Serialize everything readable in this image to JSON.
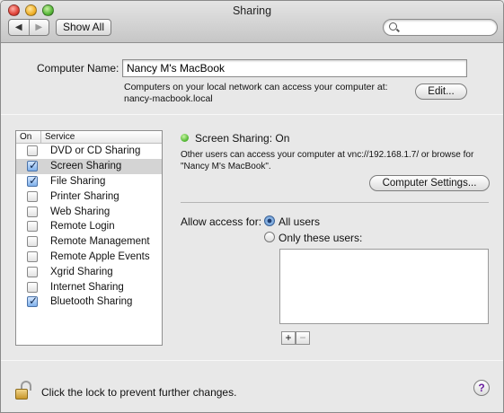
{
  "window": {
    "title": "Sharing"
  },
  "toolbar": {
    "back_glyph": "◀",
    "forward_glyph": "▶",
    "show_all_label": "Show All",
    "search_placeholder": ""
  },
  "computer_name": {
    "label": "Computer Name:",
    "value": "Nancy M's MacBook",
    "note": "Computers on your local network can access your computer at: nancy-macbook.local",
    "edit_label": "Edit..."
  },
  "services": {
    "header_on": "On",
    "header_service": "Service",
    "items": [
      {
        "label": "DVD or CD Sharing",
        "on": false,
        "selected": false
      },
      {
        "label": "Screen Sharing",
        "on": true,
        "selected": true
      },
      {
        "label": "File Sharing",
        "on": true,
        "selected": false
      },
      {
        "label": "Printer Sharing",
        "on": false,
        "selected": false
      },
      {
        "label": "Web Sharing",
        "on": false,
        "selected": false
      },
      {
        "label": "Remote Login",
        "on": false,
        "selected": false
      },
      {
        "label": "Remote Management",
        "on": false,
        "selected": false
      },
      {
        "label": "Remote Apple Events",
        "on": false,
        "selected": false
      },
      {
        "label": "Xgrid Sharing",
        "on": false,
        "selected": false
      },
      {
        "label": "Internet Sharing",
        "on": false,
        "selected": false
      },
      {
        "label": "Bluetooth Sharing",
        "on": true,
        "selected": false
      }
    ]
  },
  "detail": {
    "status": "Screen Sharing: On",
    "status_color": "#52b832",
    "description": "Other users can access your computer at vnc://192.168.1.7/ or browse for \"Nancy M's MacBook\".",
    "settings_button": "Computer Settings...",
    "access_label": "Allow access for:",
    "option_all": "All users",
    "option_only": "Only these users:",
    "selected_option": "all",
    "add_label": "+",
    "remove_label": "−"
  },
  "footer": {
    "lock_text": "Click the lock to prevent further changes.",
    "help_label": "?"
  }
}
